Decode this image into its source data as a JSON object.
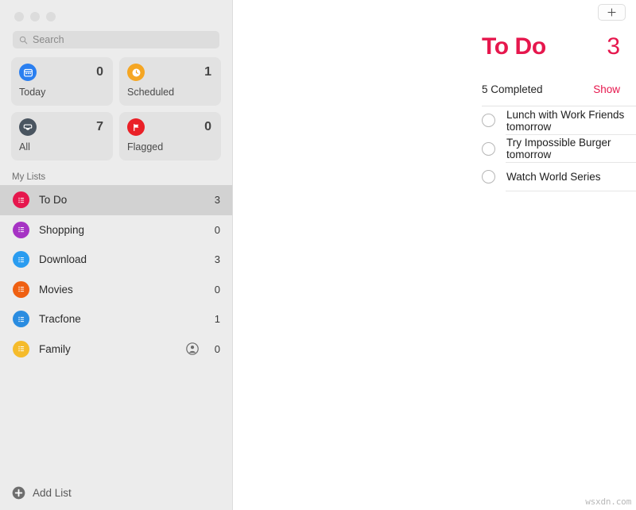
{
  "window": {
    "traffic_lights": [
      "close",
      "minimize",
      "zoom"
    ]
  },
  "sidebar": {
    "search": {
      "placeholder": "Search",
      "value": "",
      "icon": "search-icon"
    },
    "smart_lists": [
      {
        "id": "today",
        "label": "Today",
        "count": "0",
        "color": "#2a7ff0",
        "icon": "calendar-icon"
      },
      {
        "id": "scheduled",
        "label": "Scheduled",
        "count": "1",
        "color": "#f5a623",
        "icon": "clock-icon"
      },
      {
        "id": "all",
        "label": "All",
        "count": "7",
        "color": "#4a5560",
        "icon": "tray-icon"
      },
      {
        "id": "flagged",
        "label": "Flagged",
        "count": "0",
        "color": "#ea2027",
        "icon": "flag-icon"
      }
    ],
    "my_lists_heading": "My Lists",
    "lists": [
      {
        "id": "to-do",
        "label": "To Do",
        "count": "3",
        "color": "#e6174d",
        "selected": true,
        "shared": false
      },
      {
        "id": "shopping",
        "label": "Shopping",
        "count": "0",
        "color": "#a633c4",
        "selected": false,
        "shared": false
      },
      {
        "id": "download",
        "label": "Download",
        "count": "3",
        "color": "#2a9cf0",
        "selected": false,
        "shared": false
      },
      {
        "id": "movies",
        "label": "Movies",
        "count": "0",
        "color": "#ef6012",
        "selected": false,
        "shared": false
      },
      {
        "id": "tracfone",
        "label": "Tracfone",
        "count": "1",
        "color": "#2a8ce0",
        "selected": false,
        "shared": false
      },
      {
        "id": "family",
        "label": "Family",
        "count": "0",
        "color": "#f5bb2b",
        "selected": false,
        "shared": true
      }
    ],
    "add_list_label": "Add List",
    "add_list_icon": "plus-circle-icon"
  },
  "main": {
    "add_button_icon": "plus-icon",
    "title": "To Do",
    "title_count": "3",
    "accent_color": "#e6174d",
    "completed_label": "5 Completed",
    "show_label": "Show",
    "tasks": [
      {
        "text": "Lunch with Work Friends tomorrow",
        "done": false
      },
      {
        "text": "Try Impossible Burger tomorrow",
        "done": false
      },
      {
        "text": "Watch World Series",
        "done": false
      }
    ]
  },
  "watermark": "wsxdn.com"
}
